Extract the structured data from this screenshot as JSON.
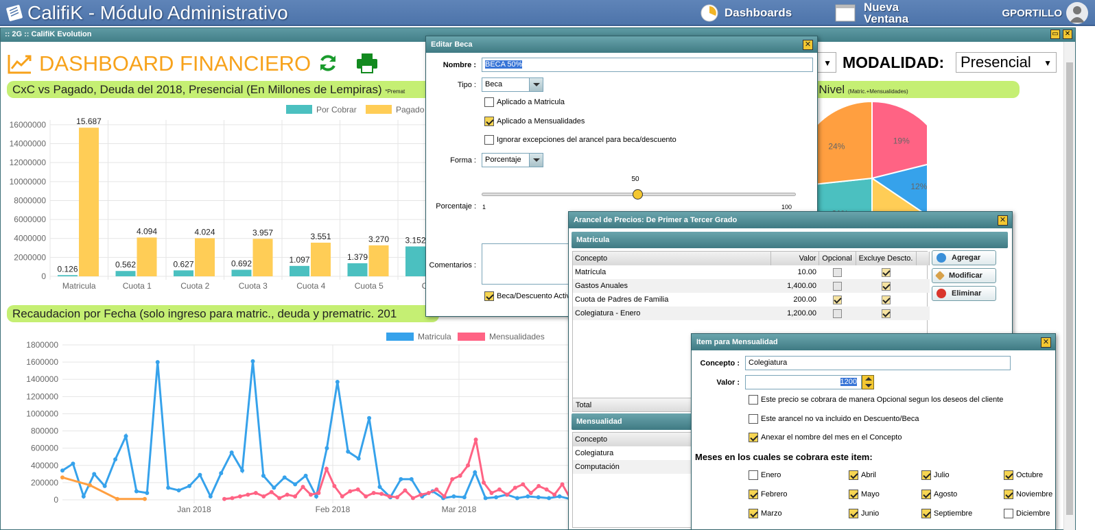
{
  "topbar": {
    "title": "CalifiK - Módulo Administrativo",
    "dashboards_label": "Dashboards",
    "nueva_ventana_line1": "Nueva",
    "nueva_ventana_line2": "Ventana",
    "user": "GPORTILLO"
  },
  "window": {
    "title": ":: 2G :: CalifiK Evolution",
    "minimize": "▭",
    "close": "✕"
  },
  "dashboard": {
    "title": "DASHBOARD FINANCIERO",
    "modalidad_label": "MODALIDAD:",
    "modalidad_value": "Presencial",
    "select_arrow": "▼"
  },
  "chart1": {
    "header": "CxC vs Pagado, Deuda del 2018, Presencial (En Millones de Lempiras)",
    "header_note": "*Premat",
    "chart_data": {
      "type": "bar",
      "categories": [
        "Matricula",
        "Cuota 1",
        "Cuota 2",
        "Cuota 3",
        "Cuota 4",
        "Cuota 5",
        "Cu"
      ],
      "series": [
        {
          "name": "Por Cobrar",
          "color": "#4bc0c0",
          "values": [
            126000,
            562000,
            627000,
            692000,
            1097000,
            1379000,
            3152000
          ],
          "labels": [
            "0.126",
            "0.562",
            "0.627",
            "0.692",
            "1.097",
            "1.379",
            "3.152"
          ]
        },
        {
          "name": "Pagado",
          "color": "#ffcd56",
          "values": [
            15687000,
            4094000,
            4024000,
            3957000,
            3551000,
            3270000,
            null
          ],
          "labels": [
            "15.687",
            "4.094",
            "4.024",
            "3.957",
            "3.551",
            "3.270",
            ""
          ]
        }
      ],
      "yticks": [
        "0",
        "2000000",
        "4000000",
        "6000000",
        "8000000",
        "10000000",
        "12000000",
        "14000000",
        "16000000"
      ],
      "ylim": [
        0,
        16500000
      ]
    }
  },
  "chart2": {
    "header": "Recaudacion por Fecha (solo ingreso para matric., deuda y prematric. 201",
    "chart_data": {
      "type": "line",
      "legend": [
        "Matricula",
        "Mensualidades"
      ],
      "xticks": [
        "Jan 2018",
        "Feb 2018",
        "Mar 2018"
      ],
      "yticks": [
        "0",
        "200000",
        "400000",
        "600000",
        "800000",
        "1000000",
        "1200000",
        "1400000",
        "1600000",
        "1800000"
      ],
      "ylim": [
        0,
        1800000
      ],
      "series": [
        {
          "name": "Matricula",
          "color": "#36a2eb",
          "values": [
            340000,
            420000,
            40000,
            300000,
            160000,
            470000,
            740000,
            100000,
            80000,
            1600000,
            140000,
            110000,
            160000,
            290000,
            40000,
            310000,
            550000,
            340000,
            1610000,
            280000,
            140000,
            260000,
            180000,
            280000,
            40000,
            600000,
            1370000,
            560000,
            480000,
            950000,
            150000,
            30000,
            240000,
            240000,
            40000,
            100000,
            20000,
            40000,
            30000,
            320000,
            20000,
            30000,
            60000,
            20000,
            40000,
            30000,
            20000,
            40000,
            10000
          ]
        },
        {
          "name": "Mensualidades",
          "color": "#ff6384",
          "values": [
            10000,
            20000,
            40000,
            60000,
            80000,
            40000,
            90000,
            20000,
            60000,
            40000,
            150000,
            60000,
            80000,
            360000,
            160000,
            40000,
            100000,
            120000,
            40000,
            80000,
            70000,
            40000,
            30000,
            110000,
            20000,
            60000,
            80000,
            120000,
            40000,
            240000,
            280000,
            400000,
            700000,
            200000,
            80000,
            120000,
            60000,
            140000,
            180000,
            80000,
            160000,
            120000,
            60000,
            180000,
            20000
          ]
        },
        {
          "name": "",
          "color": "#ff9f40",
          "values": [
            260000,
            170000,
            10000,
            10000
          ]
        }
      ]
    }
  },
  "chart3": {
    "header_visible": "r Nivel",
    "header_note": "(Matric.+Mensualidades)",
    "chart_data": {
      "type": "pie",
      "slices": [
        {
          "label": "19%",
          "value": 19,
          "color": "#ff6384"
        },
        {
          "label": "12%",
          "value": 12,
          "color": "#36a2eb"
        },
        {
          "label": "",
          "value": 14,
          "color": "#ffcd56"
        },
        {
          "label": "21%",
          "value": 21,
          "color": "#4bc0c0"
        },
        {
          "label": "24%",
          "value": 24,
          "color": "#ff9f40"
        }
      ]
    }
  },
  "editar_beca": {
    "title": "Editar Beca",
    "nombre_label": "Nombre :",
    "nombre_value": "BECA 50%",
    "tipo_label": "Tipo :",
    "tipo_value": "Beca",
    "cb_matricula": "Aplicado a Matricula",
    "cb_mensualidades": "Aplicado a Mensualidades",
    "cb_ignorar": "Ignorar excepciones del arancel para beca/descuento",
    "forma_label": "Forma :",
    "forma_value": "Porcentaje",
    "porcentaje_label": "Porcentaje :",
    "slider_value": "50",
    "slider_min": "1",
    "slider_max": "100",
    "slider_level": 50,
    "comentarios_label": "Comentarios :",
    "cb_activo": "Beca/Descuento Activ"
  },
  "arancel": {
    "title": "Arancel de Precios: De Primer a Tercer Grado",
    "matricula_header": "Matricula",
    "columns": [
      "Concepto",
      "Valor",
      "Opcional",
      "Excluye Descto."
    ],
    "rows": [
      {
        "concepto": "Matrícula",
        "valor": "10.00",
        "opcional": false,
        "excluye": true
      },
      {
        "concepto": "Gastos Anuales",
        "valor": "1,400.00",
        "opcional": false,
        "excluye": true
      },
      {
        "concepto": "Cuota de Padres de Familia",
        "valor": "200.00",
        "opcional": true,
        "excluye": true
      },
      {
        "concepto": "Colegiatura - Enero",
        "valor": "1,200.00",
        "opcional": false,
        "excluye": true
      }
    ],
    "total_label": "Total",
    "mensualidad_header": "Mensualidad",
    "mens_columns": [
      "Concepto"
    ],
    "mens_rows": [
      "Colegiatura",
      "Computación"
    ],
    "btn_agregar": "Agregar",
    "btn_modificar": "Modificar",
    "btn_eliminar": "Eliminar"
  },
  "item_mensualidad": {
    "title": "Item para Mensualidad",
    "concepto_label": "Concepto :",
    "concepto_value": "Colegiatura",
    "valor_label": "Valor :",
    "valor_value": "1200",
    "cb_opcional": "Este precio se cobrara de manera Opcional segun los deseos del cliente",
    "cb_no_incluido": "Este arancel no va incluido en Descuento/Beca",
    "cb_anexar": "Anexar el nombre del mes en el Concepto",
    "meses_title": "Meses en los cuales se cobrara este item:",
    "meses": [
      {
        "name": "Enero",
        "on": false
      },
      {
        "name": "Abril",
        "on": true
      },
      {
        "name": "Julio",
        "on": true
      },
      {
        "name": "Octubre",
        "on": true
      },
      {
        "name": "Febrero",
        "on": true
      },
      {
        "name": "Mayo",
        "on": true
      },
      {
        "name": "Agosto",
        "on": true
      },
      {
        "name": "Noviembre",
        "on": true
      },
      {
        "name": "Marzo",
        "on": true
      },
      {
        "name": "Junio",
        "on": true
      },
      {
        "name": "Septiembre",
        "on": true
      },
      {
        "name": "Diciembre",
        "on": false
      }
    ]
  }
}
